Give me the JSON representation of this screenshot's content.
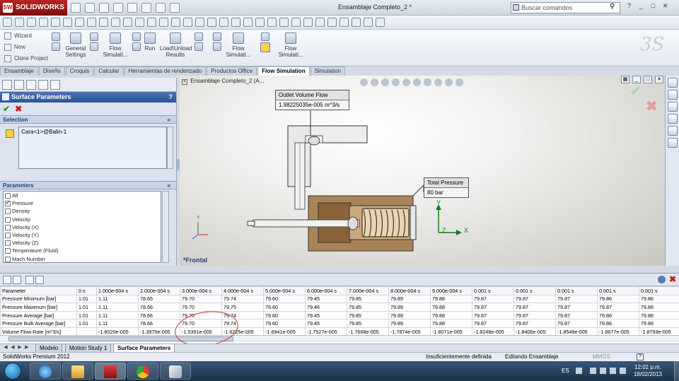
{
  "app": {
    "logo": "SOLIDWORKS",
    "logo_mark": "SW",
    "document_title": "Ensamblaje Completo_2 *",
    "search_placeholder": "Buscar comandos"
  },
  "command_manager": {
    "wizard": "Wizard",
    "new": "New",
    "clone_project": "Clone Project",
    "general_settings_1": "General",
    "general_settings_2": "Settings",
    "flow_simulation_1_a": "Flow",
    "flow_simulation_1_b": "Simulati...",
    "run": "Run",
    "load_unload_1": "Load\\Unload",
    "load_unload_2": "Results",
    "flow_simulation_2_a": "Flow",
    "flow_simulation_2_b": "Simulati...",
    "flow_simulation_3_a": "Flow",
    "flow_simulation_3_b": "Simulati..."
  },
  "tabs": [
    {
      "label": "Ensamblaje"
    },
    {
      "label": "Diseño"
    },
    {
      "label": "Croquis"
    },
    {
      "label": "Calcular"
    },
    {
      "label": "Herramientas de renderizado"
    },
    {
      "label": "Productos Office"
    },
    {
      "label": "Flow Simulation"
    },
    {
      "label": "Simulation"
    }
  ],
  "property_manager": {
    "title": "Surface Parameters",
    "help": "?",
    "ok": "✔",
    "cancel": "✖",
    "selection_header": "Selection",
    "selection_item": "Cara<1>@Balin-1",
    "parameters_header": "Parameters",
    "collapse_glyph": "«",
    "parameters": [
      {
        "label": "All",
        "checked": false
      },
      {
        "label": "Pressure",
        "checked": true
      },
      {
        "label": "Density",
        "checked": false
      },
      {
        "label": "Velocity",
        "checked": false
      },
      {
        "label": "Velocity (X)",
        "checked": false
      },
      {
        "label": "Velocity (Y)",
        "checked": false
      },
      {
        "label": "Velocity (Z)",
        "checked": false
      },
      {
        "label": "Temperature (Fluid)",
        "checked": false
      },
      {
        "label": "Mach Number",
        "checked": false
      }
    ]
  },
  "viewport": {
    "tree_item": "Ensamblaje Completo_2  (A...",
    "view_name": "*Frontal",
    "callout_outlet": {
      "title": "Outlet Volume Flow",
      "value": "1.98225035e-005 m^3/s"
    },
    "callout_pressure": {
      "title": "Total Pressure",
      "value": "80 bar"
    },
    "axis_x": "X",
    "axis_y": "Y",
    "axis_z": "Z"
  },
  "results_table": {
    "headers": [
      "Parameter",
      "0 s",
      "1.000e-004 s",
      "2.000e-004 s",
      "3.000e-004 s",
      "4.000e-004 s",
      "5.000e-004 s",
      "6.000e-004 s",
      "7.000e-004 s",
      "8.000e-004 s",
      "9.000e-004 s",
      "0.001 s",
      "0.001 s",
      "0.001 s",
      "0.001 s",
      "0.001 s"
    ],
    "rows": [
      [
        "Pressure Minimum [bar]",
        "1.01",
        "1.11",
        "78.65",
        "79.70",
        "79.74",
        "79.60",
        "79.45",
        "79.85",
        "79.89",
        "79.88",
        "79.87",
        "79.87",
        "79.87",
        "79.86",
        "79.86"
      ],
      [
        "Pressure Maximum [bar]",
        "1.01",
        "1.11",
        "78.66",
        "79.70",
        "79.75",
        "79.60",
        "79.46",
        "79.85",
        "79.89",
        "79.88",
        "79.87",
        "79.87",
        "79.87",
        "79.87",
        "79.86"
      ],
      [
        "Pressure Average [bar]",
        "1.01",
        "1.11",
        "78.66",
        "79.70",
        "79.74",
        "79.60",
        "79.45",
        "79.85",
        "79.89",
        "79.88",
        "79.87",
        "79.87",
        "79.87",
        "79.86",
        "79.86"
      ],
      [
        "Pressure Bulk Average [bar]",
        "1.01",
        "1.11",
        "78.66",
        "79.70",
        "79.74",
        "79.60",
        "79.45",
        "79.85",
        "79.89",
        "79.88",
        "79.87",
        "79.87",
        "79.87",
        "79.86",
        "79.86"
      ],
      [
        "Volume Flow Rate [m^3/s]",
        "",
        "-1.8020e-005",
        "-1.3970e-005",
        "-1.5391e-005",
        "-1.6225e-005",
        "-1.6941e-005",
        "-1.7527e-005",
        "-1.7668e-005",
        "-1.7874e-005",
        "-1.8071e-005",
        "-1.8248e-005",
        "-1.8406e-005",
        "-1.8549e-005",
        "-1.8677e-005",
        "-1.8793e-005"
      ]
    ]
  },
  "bottom_tabs": [
    {
      "label": "Modelo"
    },
    {
      "label": "Motion Study 1"
    },
    {
      "label": "Surface Parameters"
    }
  ],
  "status_bar": {
    "product": "SolidWorks Premium 2012",
    "definition": "Insuficientemente definida",
    "mode": "Editando Ensamblaje",
    "units": "MMGS",
    "help": "?"
  },
  "taskbar": {
    "language": "ES",
    "time": "12:01 p.m.",
    "date": "18/02/2013"
  },
  "colors": {
    "accent": "#2e5497",
    "ok": "#1f9b27",
    "cancel": "#c41f1f",
    "annotation": "#d12b2b"
  }
}
